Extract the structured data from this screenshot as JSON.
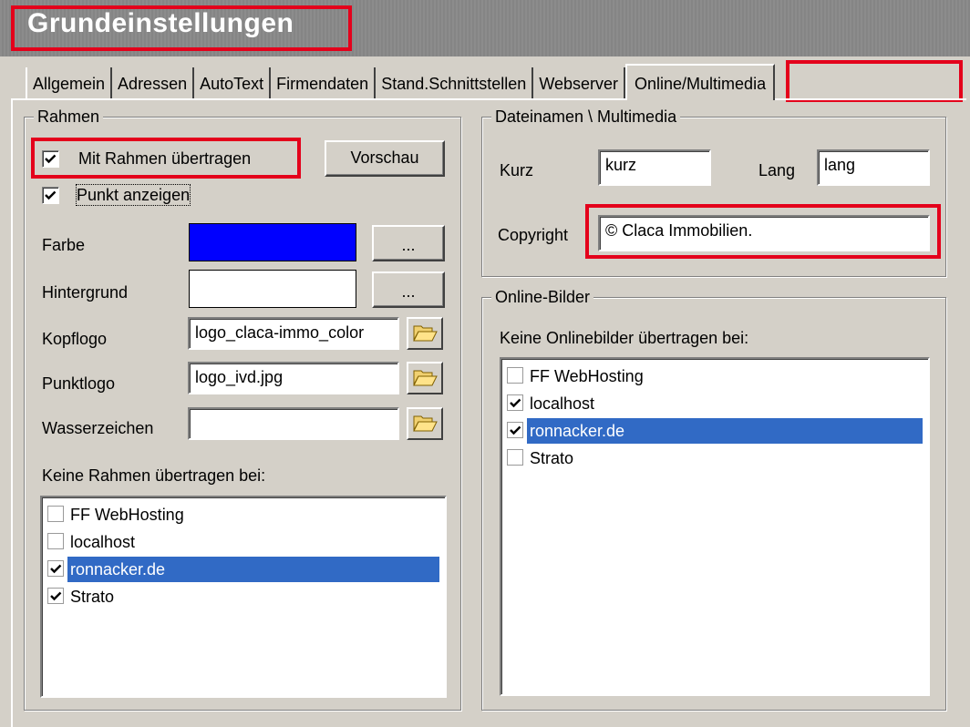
{
  "window": {
    "title": "Grundeinstellungen"
  },
  "tabs": [
    {
      "label": "Allgemein"
    },
    {
      "label": "Adressen"
    },
    {
      "label": "AutoText"
    },
    {
      "label": "Firmendaten"
    },
    {
      "label": "Stand.Schnittstellen"
    },
    {
      "label": "Webserver"
    },
    {
      "label": "Online/Multimedia",
      "active": true
    }
  ],
  "rahmen": {
    "legend": "Rahmen",
    "mit_rahmen": {
      "label": "Mit Rahmen übertragen",
      "checked": true
    },
    "vorschau_label": "Vorschau",
    "punkt_anzeigen": {
      "label": "Punkt anzeigen",
      "checked": true
    },
    "farbe": {
      "label": "Farbe",
      "color": "#0000ff",
      "button": "..."
    },
    "hintergrund": {
      "label": "Hintergrund",
      "color": "#ffffff",
      "button": "..."
    },
    "kopflogo": {
      "label": "Kopflogo",
      "value": "logo_claca-immo_color"
    },
    "punktlogo": {
      "label": "Punktlogo",
      "value": "logo_ivd.jpg"
    },
    "wasserzeichen": {
      "label": "Wasserzeichen",
      "value": ""
    },
    "list_label": "Keine Rahmen übertragen bei:",
    "list": [
      {
        "label": "FF WebHosting",
        "checked": false,
        "selected": false
      },
      {
        "label": "localhost",
        "checked": false,
        "selected": false
      },
      {
        "label": "ronnacker.de",
        "checked": true,
        "selected": true
      },
      {
        "label": "Strato",
        "checked": true,
        "selected": false
      }
    ]
  },
  "dateinamen": {
    "legend": "Dateinamen \\ Multimedia",
    "kurz": {
      "label": "Kurz",
      "value": "kurz"
    },
    "lang": {
      "label": "Lang",
      "value": "lang"
    },
    "copyright": {
      "label": "Copyright",
      "value": "© Claca Immobilien."
    }
  },
  "online_bilder": {
    "legend": "Online-Bilder",
    "list_label": "Keine Onlinebilder übertragen bei:",
    "list": [
      {
        "label": "FF WebHosting",
        "checked": false,
        "selected": false
      },
      {
        "label": "localhost",
        "checked": true,
        "selected": false
      },
      {
        "label": "ronnacker.de",
        "checked": true,
        "selected": true
      },
      {
        "label": "Strato",
        "checked": false,
        "selected": false
      }
    ]
  },
  "colors": {
    "highlight": "#e4001b",
    "selection": "#316ac5",
    "face": "#d4d0c8"
  },
  "icons": {
    "folder": "folder-open-icon",
    "check": "check-icon"
  }
}
